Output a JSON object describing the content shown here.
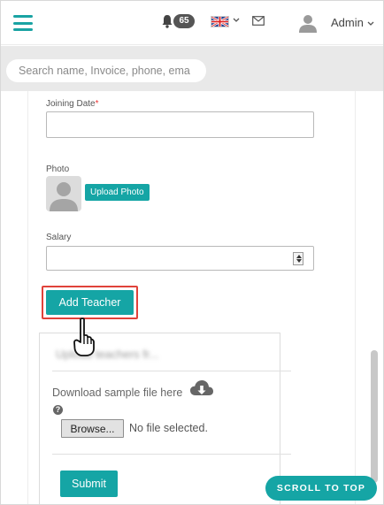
{
  "header": {
    "notification_count": "65",
    "language_flag": "uk-flag",
    "user_label": "Admin"
  },
  "search": {
    "placeholder": "Search name, Invoice, phone, ema"
  },
  "form": {
    "joining_date_label": "Joining Date",
    "required_mark": "*",
    "photo_label": "Photo",
    "upload_photo_label": "Upload Photo",
    "salary_label": "Salary",
    "add_teacher_label": "Add Teacher"
  },
  "upload_card": {
    "title": "Upload teachers fr...",
    "download_text": "Download sample file here",
    "help_glyph": "?",
    "browse_label": "Browse...",
    "no_file_text": "No file selected.",
    "submit_label": "Submit"
  },
  "scroll_to_top_label": "SCROLL TO TOP",
  "colors": {
    "accent": "#15a5a5",
    "highlight": "#e0423a"
  },
  "icons": [
    "hamburger-icon",
    "bell-icon",
    "uk-flag-icon",
    "mail-icon",
    "user-avatar-icon",
    "photo-placeholder-icon",
    "pointing-hand-icon",
    "cloud-download-icon",
    "help-icon"
  ]
}
